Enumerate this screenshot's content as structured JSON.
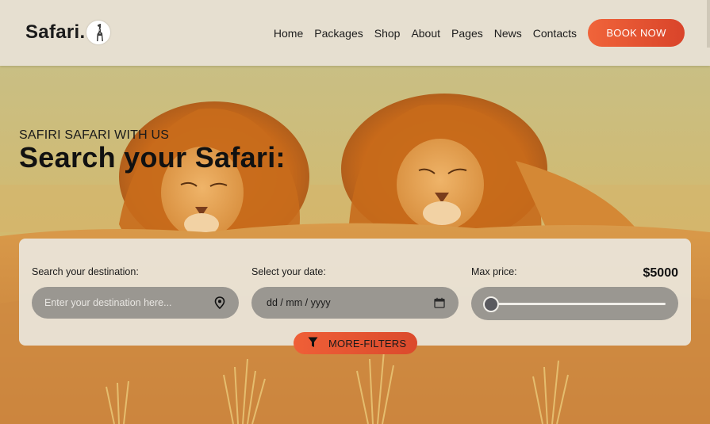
{
  "header": {
    "logo_text": "Safari.",
    "nav": [
      "Home",
      "Packages",
      "Shop",
      "About",
      "Pages",
      "News",
      "Contacts"
    ],
    "cta_label": "BOOK NOW"
  },
  "hero": {
    "eyebrow": "SAFIRI SAFARI WITH US",
    "title": "Search your Safari:"
  },
  "search": {
    "destination": {
      "label": "Search your destination:",
      "placeholder": "Enter your destination here...",
      "icon": "location-pin-icon"
    },
    "date": {
      "label": "Select your date:",
      "value": "dd / mm / yyyy",
      "icon": "calendar-icon"
    },
    "price": {
      "label": "Max price:",
      "value": "$5000",
      "level": 0
    },
    "more_filters_label": "MORE-FILTERS",
    "more_filters_icon": "filter-icon"
  },
  "colors": {
    "accent": "#e8552f",
    "header_bg": "#e6dfd0",
    "panel_bg": "#e9e3d6",
    "field_bg": "#9a9791"
  }
}
